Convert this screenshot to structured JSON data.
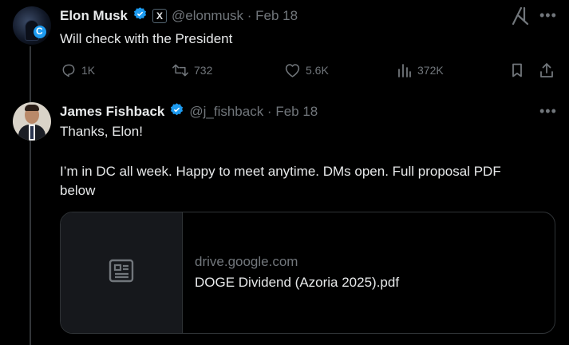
{
  "tweets": [
    {
      "name": "Elon Musk",
      "handle_date": "@elonmusk · Feb 18",
      "text": "Will check with the President",
      "affiliate_badge": "X",
      "actions": {
        "replies": "1K",
        "retweets": "732",
        "likes": "5.6K",
        "views": "372K"
      }
    },
    {
      "name": "James Fishback",
      "handle_date": "@j_fishback · Feb 18",
      "text_line1": "Thanks, Elon!",
      "text_line2": "I’m in DC all week. Happy to meet anytime. DMs open. Full proposal PDF",
      "text_line3": "below",
      "link_card": {
        "domain": "drive.google.com",
        "title": "DOGE Dividend (Azoria 2025).pdf"
      }
    }
  ],
  "colors": {
    "background": "#000000",
    "text": "#e7e9ea",
    "muted": "#71767b",
    "verified": "#1d9bf0",
    "border": "#2f3336"
  },
  "icons": [
    "grok-icon",
    "more-icon",
    "reply-icon",
    "retweet-icon",
    "like-icon",
    "views-icon",
    "bookmark-icon",
    "share-icon",
    "document-icon",
    "verified-icon"
  ]
}
